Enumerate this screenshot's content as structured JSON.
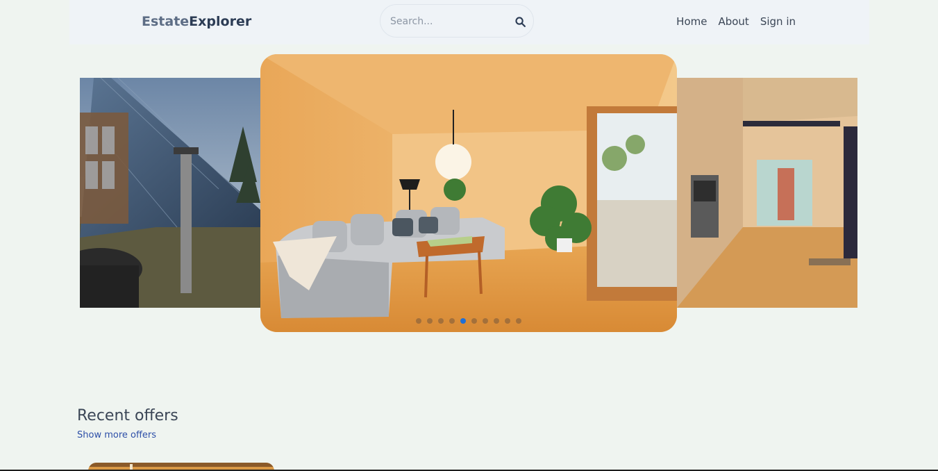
{
  "brand": {
    "part1": "Estate",
    "part2": "Explorer"
  },
  "search": {
    "placeholder": "Search..."
  },
  "nav": {
    "items": [
      "Home",
      "About",
      "Sign in"
    ]
  },
  "carousel": {
    "slide_count": 10,
    "active_index": 4
  },
  "recent": {
    "title": "Recent offers",
    "show_more": "Show more offers"
  }
}
